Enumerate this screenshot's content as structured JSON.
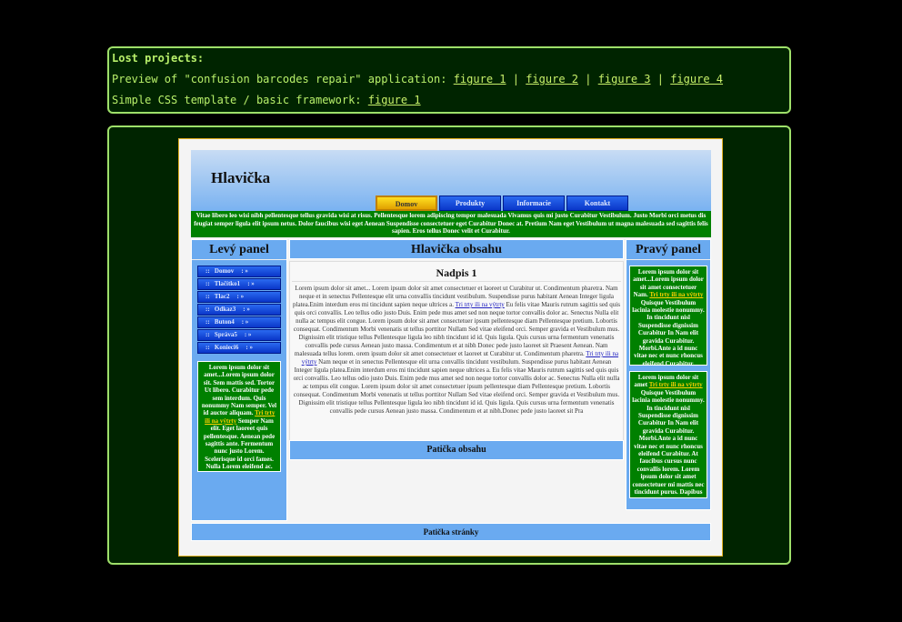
{
  "lost": {
    "title": "Lost projects:",
    "line1_text": "Preview of \"confusion barcodes repair\" application:",
    "line1_links": [
      "figure 1",
      "figure 2",
      "figure 3",
      "figure 4"
    ],
    "separator": "|",
    "line2_text": "Simple CSS template / basic framework:",
    "line2_link": "figure 1"
  },
  "template": {
    "header_title": "Hlavička",
    "nav": [
      "Domov",
      "Produkty",
      "Informacie",
      "Kontakt"
    ],
    "banner": "Vitae libero leo wisi nibh pellentesque tellus gravida wisi at risus. Pellentesque lorem adipiscing tempor malesuada Vivamus quis mi justo Curabitur Vestibulum. Justo Morbi orci metus dis feugiat semper ligula elit ipsum netus. Dolor faucibus wisi eget Aenean Suspendisse consectetuer eget Curabitur Donec at. Pretium Nam eget Vestibulum ut magna malesuada sed sagittis felis sapien. Eros tellus Donec velit et Curabitur.",
    "left": {
      "title": "Levý panel",
      "menu_prefix": "::",
      "menu_suffix": ": »",
      "menu": [
        "Domov",
        "Tlačítko1",
        "Tlac2",
        "Odkaz3",
        "Buton4",
        "Správa5",
        "Konieci6"
      ],
      "box": {
        "pre": "Lorem ipsum dolor sit amet...Lorem ipsum dolor sit. Sem mattis sed. Tortor Ut libero. Curabitur pede sem interdum. Quis nonummy Nam semper. Vel id auctor aliquam.",
        "link": "Tri trty ili na výtrty",
        "post": "Semper Nam elit. Eget laoreet quis pellentesque. Aenean pede sagittis ante. Fermentum nunc justo Lorem. Scelerisque id orci fames. Nulla Lorem eleifend ac."
      }
    },
    "content": {
      "title": "Hlavička obsahu",
      "heading": "Nadpis 1",
      "p1": "Lorem ipsum dolor sit amet... Lorem ipsum dolor sit amet consectetuer et laoreet ut Curabitur ut. Condimentum pharetra. Nam neque et in senectus Pellentesque elit urna convallis tincidunt vestibulum. Suspendisse purus habitant Aenean Integer ligula platea.Enim interdum eros mi tincidunt sapien neque ultrices a.",
      "link1": "Tri trty ili na výtrty",
      "p2": "Eu felis vitae Mauris rutrum sagittis sed quis quis orci convallis. Leo tellus odio justo Duis. Enim pede mus amet sed non neque tortor convallis dolor ac. Senectus Nulla elit nulla ac tempus elit congue. Lorem ipsum dolor sit amet consectetuer ipsum pellentesque diam Pellentesque pretium. Lobortis consequat. Condimentum Morbi venenatis ut tellus porttitor Nullam Sed vitae eleifend orci. Semper gravida et Vestibulum mus. Dignissim elit tristique tellus Pellentesque ligula leo nibh tincidunt id id. Quis ligula. Quis cursus urna fermentum venenatis convallis pede cursus Aenean justo massa. Condimentum et at nibh Donec pede justo laoreet sit Praesent Aenean. Nam malesuada tellus lorem. orem ipsum dolor sit amet consectetuer et laoreet ut Curabitur ut. Condimentum pharetra.",
      "link2": "Tri trty ili na výtrty",
      "p3": "Nam neque et in senectus Pellentesque elit urna convallis tincidunt vestibulum. Suspendisse purus habitant Aenean Integer ligula platea.Enim interdum eros mi tincidunt sapien neque ultrices a. Eu felis vitae Mauris rutrum sagittis sed quis quis orci convallis. Leo tellus odio justo Duis. Enim pede mus amet sed non neque tortor convallis dolor ac. Senectus Nulla elit nulla ac tempus elit congue. Lorem ipsum dolor sit amet consectetuer ipsum pellentesque diam Pellentesque pretium. Lobortis consequat. Condimentum Morbi venenatis ut tellus porttitor Nullam Sed vitae eleifend orci. Semper gravida et Vestibulum mus. Dignissim elit tristique tellus Pellentesque ligula leo nibh tincidunt id id. Quis ligula. Quis cursus urna fermentum venenatis convallis pede cursus Aenean justo massa. Condimentum et at nibh.Donec pede justo laoreet sit Pra",
      "footer": "Patička obsahu"
    },
    "right": {
      "title": "Pravý panel",
      "box1": {
        "pre": "Lorem ipsum dolor sit amet...Lorem ipsum dolor sit amet consectetuer Nam.",
        "link": "Tri trty ili na výtrty",
        "post": "Quisque Vestibulum lacinia molestie nonummy. In tincidunt nisl Suspendisse dignissim Curabitur In Nam elit gravida Curabitur. Morbi.Ante a id nunc vitae nec et nunc rhoncus eleifend Curabitur."
      },
      "box2": {
        "pre": "Lorem ipsum dolor sit amet",
        "link": "Tri trty ili na výtrty",
        "post": "Quisque Vestibulum lacinia molestie nonummy. In tincidunt nisl Suspendisse dignissim Curabitur In Nam elit gravida Curabitur. Morbi.Ante a id nunc vitae nec et nunc rhoncus eleifend Curabitur. At faucibus cursus nunc convallis lorem. Lorem ipsum dolor sit amet consectetuer mi mattis nec tincidunt purus. Dapibus Nulla"
      }
    },
    "footer": "Patička stránky"
  }
}
